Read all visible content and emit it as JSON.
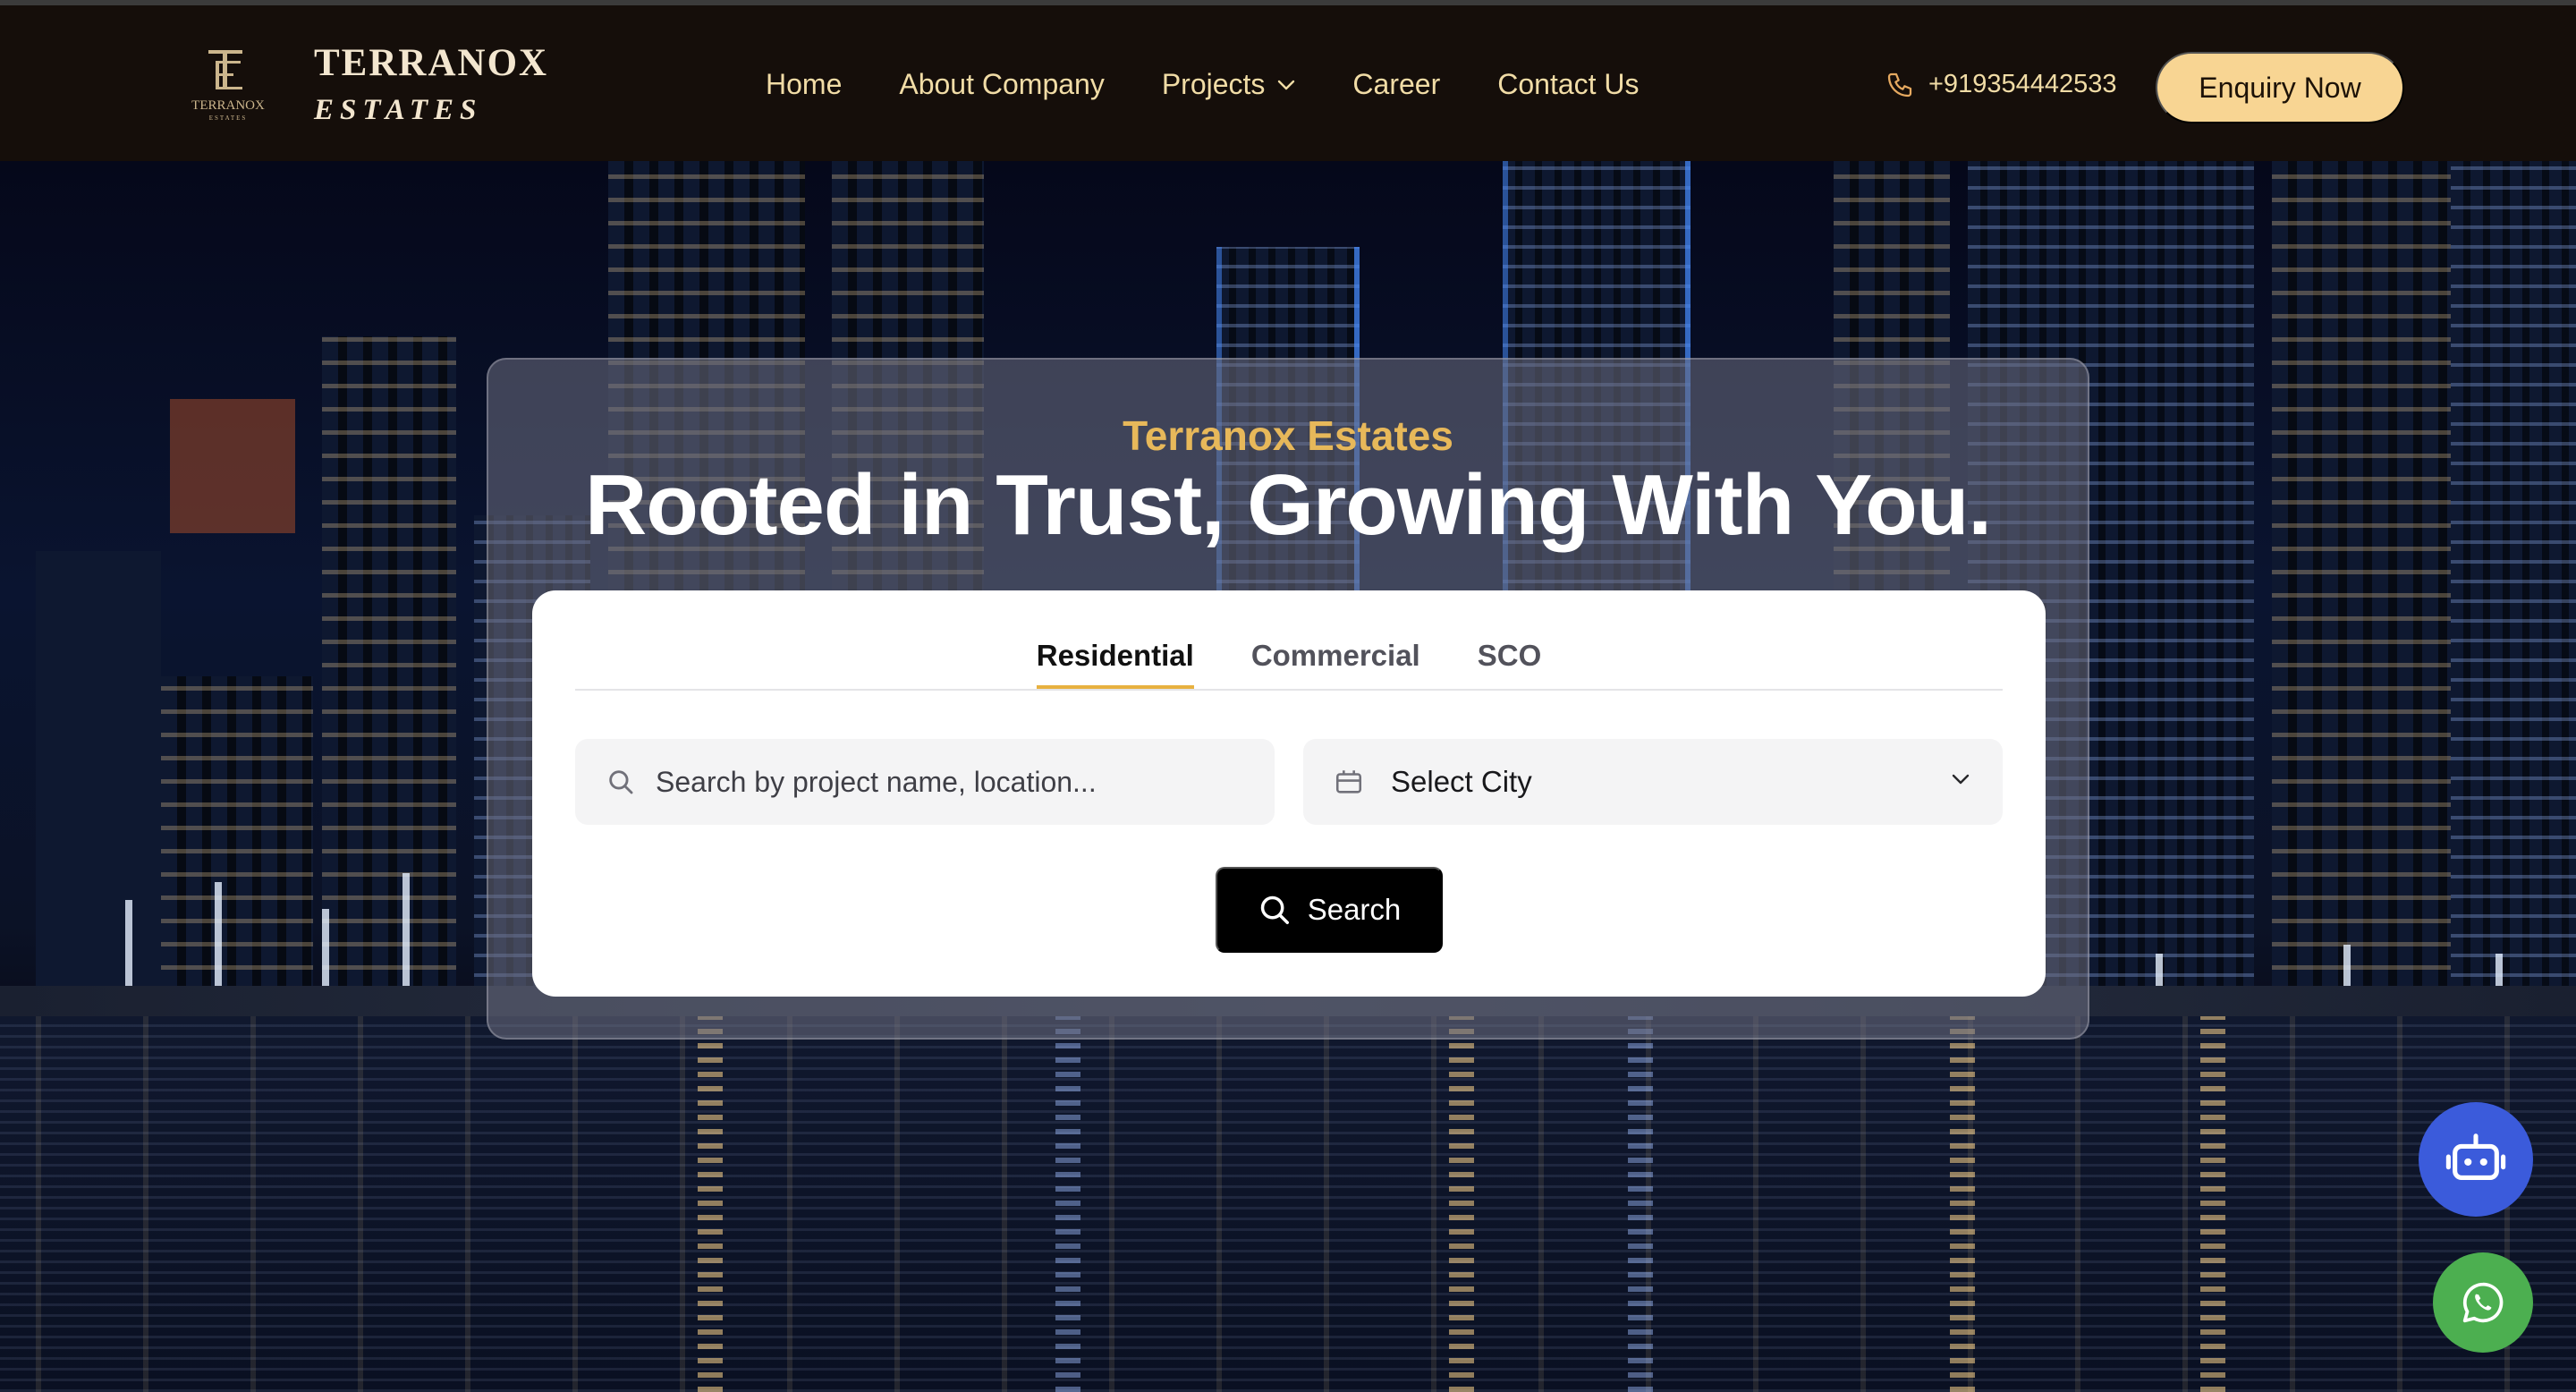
{
  "brand": {
    "monogram": "TE",
    "name_line1": "TERRANOX",
    "name_line2": "ESTATES",
    "mark_caption": "TERRANOX",
    "mark_subcaption": "ESTATES"
  },
  "nav": {
    "items": [
      {
        "label": "Home"
      },
      {
        "label": "About Company"
      },
      {
        "label": "Projects",
        "has_dropdown": true
      },
      {
        "label": "Career"
      },
      {
        "label": "Contact Us"
      }
    ]
  },
  "contact": {
    "phone": "+919354442533",
    "phone_icon": "phone-icon"
  },
  "cta": {
    "enquiry_label": "Enquiry Now"
  },
  "hero": {
    "kicker": "Terranox Estates",
    "headline": "Rooted in Trust, Growing With You."
  },
  "search_card": {
    "tabs": [
      {
        "label": "Residential",
        "active": true
      },
      {
        "label": "Commercial",
        "active": false
      },
      {
        "label": "SCO",
        "active": false
      }
    ],
    "search_placeholder": "Search by project name, location...",
    "search_value": "",
    "city_select_value": "Select City",
    "search_button_label": "Search"
  },
  "floating": {
    "chatbot_icon": "robot-icon",
    "whatsapp_icon": "whatsapp-icon"
  },
  "colors": {
    "nav_bg": "#150e0a",
    "nav_text": "#f1dca6",
    "cta_bg": "#f8d593",
    "kicker": "#e7b85a",
    "tab_underline": "#e8b140",
    "chatbot_bg": "#3b5bdb",
    "whatsapp_bg": "#4caf50"
  }
}
